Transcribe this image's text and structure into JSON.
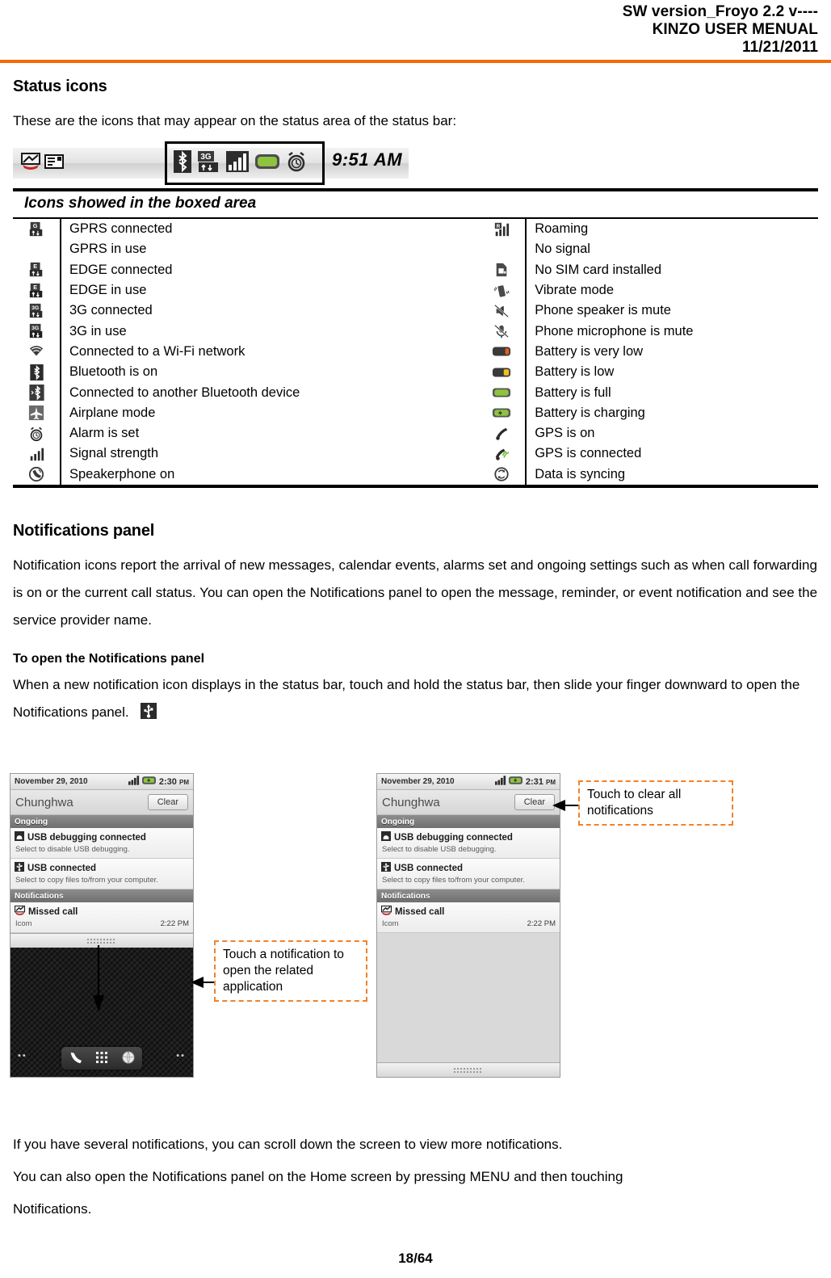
{
  "header": {
    "line1": "SW version_Froyo 2.2 v----",
    "line2": "KINZO USER MENUAL",
    "line3": "11/21/2011",
    "rule_color": "#F26B0A"
  },
  "status_icons_section": {
    "title": "Status icons",
    "intro": "These are the icons that may appear on the status area of the status bar:",
    "status_bar_mock": {
      "time": "9:51 AM",
      "left_icons": [
        "missed-call-icon",
        "message-icon"
      ],
      "boxed_icons": [
        "bluetooth-icon",
        "3g-in-use-icon",
        "signal-strength-icon",
        "battery-full-icon",
        "alarm-icon"
      ]
    },
    "boxed_area_caption": "Icons showed in the boxed area",
    "table": {
      "left_rows": [
        {
          "icon": "gprs-connected-icon",
          "label": "GPRS connected"
        },
        {
          "icon": "",
          "label": "GPRS in use"
        },
        {
          "icon": "edge-connected-icon",
          "label": "EDGE connected"
        },
        {
          "icon": "edge-in-use-icon",
          "label": "EDGE in use"
        },
        {
          "icon": "3g-connected-icon",
          "label": "3G connected"
        },
        {
          "icon": "3g-in-use-icon",
          "label": "3G in use"
        },
        {
          "icon": "wifi-icon",
          "label": "Connected to a Wi-Fi network"
        },
        {
          "icon": "bluetooth-icon",
          "label": "Bluetooth is on"
        },
        {
          "icon": "bluetooth-connected-icon",
          "label": "Connected to another Bluetooth device"
        },
        {
          "icon": "airplane-mode-icon",
          "label": "Airplane mode"
        },
        {
          "icon": "alarm-icon",
          "label": "Alarm is set"
        },
        {
          "icon": "signal-strength-icon",
          "label": "Signal strength"
        },
        {
          "icon": "speakerphone-icon",
          "label": "Speakerphone on"
        }
      ],
      "right_rows": [
        {
          "icon": "roaming-icon",
          "label": "Roaming"
        },
        {
          "icon": "",
          "label": "No signal"
        },
        {
          "icon": "no-sim-icon",
          "label": "No SIM card installed"
        },
        {
          "icon": "vibrate-icon",
          "label": "Vibrate mode"
        },
        {
          "icon": "speaker-mute-icon",
          "label": "Phone speaker is mute"
        },
        {
          "icon": "microphone-mute-icon",
          "label": "Phone microphone is mute"
        },
        {
          "icon": "battery-very-low-icon",
          "label": "Battery is very low"
        },
        {
          "icon": "battery-low-icon",
          "label": "Battery is low"
        },
        {
          "icon": "battery-full-icon",
          "label": "Battery is full"
        },
        {
          "icon": "battery-charging-icon",
          "label": "Battery is charging"
        },
        {
          "icon": "gps-on-icon",
          "label": "GPS is on"
        },
        {
          "icon": "gps-connected-icon",
          "label": "GPS is connected"
        },
        {
          "icon": "sync-icon",
          "label": "Data is syncing"
        }
      ]
    }
  },
  "notifications_section": {
    "title": "Notifications panel",
    "paragraph": "Notification icons report the arrival of new messages, calendar events, alarms set and ongoing settings such as when call forwarding is on or the current call status. You can open the Notifications panel to open the message, reminder, or event notification and see the service provider name.",
    "sub_head": "To open the Notifications panel",
    "sub_paragraph": "When a new notification icon displays in the status bar, touch and hold the status bar, then slide your finger downward to open the Notifications panel.",
    "inline_icon": "usb-icon"
  },
  "phone_left": {
    "status_date": "November 29, 2010",
    "status_time": "2:30",
    "status_ampm": "PM",
    "carrier": "Chunghwa",
    "clear_label": "Clear",
    "section_ongoing": "Ongoing",
    "section_notifications": "Notifications",
    "items": [
      {
        "icon": "usb-debug-icon",
        "title": "USB debugging connected",
        "sub": "Select to disable USB debugging."
      },
      {
        "icon": "usb-icon",
        "title": "USB connected",
        "sub": "Select to copy files to/from your computer."
      }
    ],
    "missed_call": {
      "icon": "missed-call-icon",
      "title": "Missed call",
      "name": "Icom",
      "time": "2:22 PM"
    },
    "dock_icons": [
      "phone-icon",
      "app-drawer-icon",
      "browser-icon"
    ],
    "page_dots": "••"
  },
  "phone_right": {
    "status_date": "November 29, 2010",
    "status_time": "2:31",
    "status_ampm": "PM",
    "carrier": "Chunghwa",
    "clear_label": "Clear",
    "section_ongoing": "Ongoing",
    "section_notifications": "Notifications",
    "items": [
      {
        "icon": "usb-debug-icon",
        "title": "USB debugging connected",
        "sub": "Select to disable USB debugging."
      },
      {
        "icon": "usb-icon",
        "title": "USB connected",
        "sub": "Select to copy files to/from your computer."
      }
    ],
    "missed_call": {
      "icon": "missed-call-icon",
      "title": "Missed call",
      "name": "Icom",
      "time": "2:22 PM"
    }
  },
  "callouts": {
    "clear": "Touch to clear all notifications",
    "touch": "Touch a notification to open the related application",
    "border_color": "#F28229"
  },
  "closing": {
    "line1": "If you have several notifications, you can scroll down the screen to view more notifications.",
    "line2": "You can also open the Notifications panel on the Home screen by pressing MENU and then touching",
    "line3": "Notifications."
  },
  "footer": {
    "page": "18/64"
  }
}
